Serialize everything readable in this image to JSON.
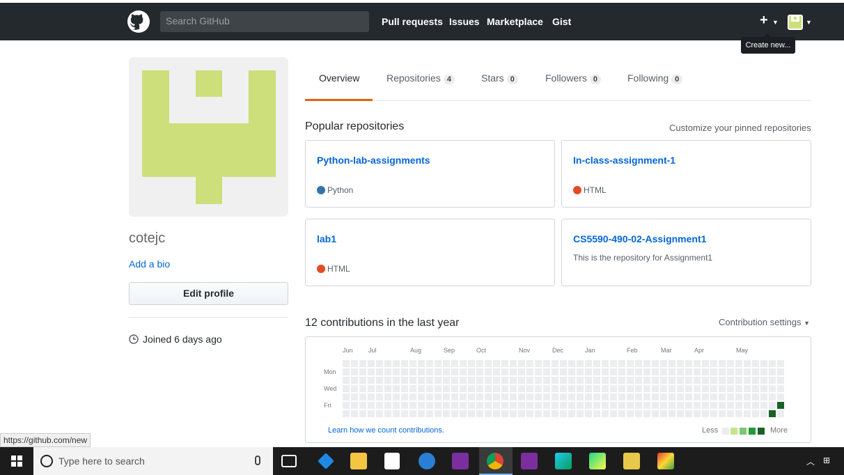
{
  "header": {
    "search_placeholder": "Search GitHub",
    "nav": [
      "Pull requests",
      "Issues",
      "Marketplace",
      "Gist"
    ],
    "plus": "+",
    "tooltip": "Create new..."
  },
  "profile": {
    "username": "cotejc",
    "bio_link": "Add a bio",
    "edit_button": "Edit profile",
    "joined": "Joined 6 days ago",
    "avatar_color": "#cddf7b"
  },
  "tabs": [
    {
      "label": "Overview",
      "count": null
    },
    {
      "label": "Repositories",
      "count": "4"
    },
    {
      "label": "Stars",
      "count": "0"
    },
    {
      "label": "Followers",
      "count": "0"
    },
    {
      "label": "Following",
      "count": "0"
    }
  ],
  "popular": {
    "title": "Popular repositories",
    "customize": "Customize your pinned repositories",
    "repos": [
      {
        "name": "Python-lab-assignments",
        "language": "Python",
        "lang_color": "#3572A5",
        "description": ""
      },
      {
        "name": "In-class-assignment-1",
        "language": "HTML",
        "lang_color": "#e34c26",
        "description": ""
      },
      {
        "name": "lab1",
        "language": "HTML",
        "lang_color": "#e34c26",
        "description": ""
      },
      {
        "name": "CS5590-490-02-Assignment1",
        "language": "",
        "lang_color": "",
        "description": "This is the repository for Assignment1"
      }
    ]
  },
  "contributions": {
    "title": "12 contributions in the last year",
    "settings": "Contribution settings",
    "months": [
      "Jun",
      "Jul",
      "Aug",
      "Sep",
      "Oct",
      "Nov",
      "Dec",
      "Jan",
      "Feb",
      "Mar",
      "Apr",
      "May"
    ],
    "days": [
      "Mon",
      "Wed",
      "Fri"
    ],
    "learn": "Learn how we count contributions.",
    "less": "Less",
    "more": "More",
    "weeks": 53,
    "active_cells": [
      {
        "week": 52,
        "day": 5,
        "level": 4
      },
      {
        "week": 51,
        "day": 6,
        "level": 4
      }
    ],
    "colors": [
      "#ebedf0",
      "#c6e48b",
      "#7bc96f",
      "#239a3b",
      "#196127"
    ]
  },
  "statusbar": "https://github.com/new",
  "taskbar": {
    "search_placeholder": "Type here to search"
  }
}
